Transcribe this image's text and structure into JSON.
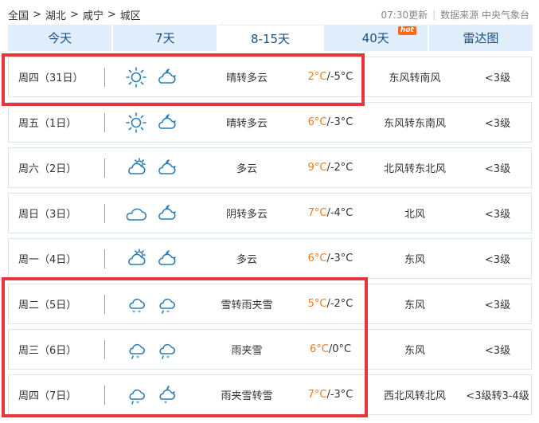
{
  "breadcrumb": [
    "全国",
    "湖北",
    "咸宁",
    "城区"
  ],
  "breadcrumb_sep": ">",
  "update": {
    "time": "07:30更新",
    "source": "数据来源 中央气象台"
  },
  "tabs": [
    {
      "label": "今天"
    },
    {
      "label": "7天"
    },
    {
      "label": "8-15天",
      "active": true
    },
    {
      "label": "40天",
      "badge": "hot"
    },
    {
      "label": "雷达图"
    }
  ],
  "forecast": [
    {
      "day": "周四（31日）",
      "icon_day": "sun-icon",
      "icon_night": "cloud-night-icon",
      "cond": "晴转多云",
      "hi": "2°C",
      "lo": "/-5°C",
      "wind": "东风转南风",
      "level": "<3级"
    },
    {
      "day": "周五（1日）",
      "icon_day": "sun-icon",
      "icon_night": "cloud-night-icon",
      "cond": "晴转多云",
      "hi": "6°C",
      "lo": "/-3°C",
      "wind": "东风转东南风",
      "level": "<3级"
    },
    {
      "day": "周六（2日）",
      "icon_day": "partly-cloudy-icon",
      "icon_night": "cloud-night-icon",
      "cond": "多云",
      "hi": "9°C",
      "lo": "/-2°C",
      "wind": "北风转东北风",
      "level": "<3级"
    },
    {
      "day": "周日（3日）",
      "icon_day": "cloud-icon",
      "icon_night": "cloud-night-icon",
      "cond": "阴转多云",
      "hi": "7°C",
      "lo": "/-4°C",
      "wind": "北风",
      "level": "<3级"
    },
    {
      "day": "周一（4日）",
      "icon_day": "partly-cloudy-icon",
      "icon_night": "cloud-night-icon",
      "cond": "多云",
      "hi": "6°C",
      "lo": "/-3°C",
      "wind": "东风",
      "level": "<3级"
    },
    {
      "day": "周二（5日）",
      "icon_day": "snow-cloud-icon",
      "icon_night": "sleet-cloud-icon",
      "cond": "雪转雨夹雪",
      "hi": "5°C",
      "lo": "/-2°C",
      "wind": "东风",
      "level": "<3级"
    },
    {
      "day": "周三（6日）",
      "icon_day": "sleet-cloud-icon",
      "icon_night": "sleet-cloud-icon",
      "cond": "雨夹雪",
      "hi": "6°C",
      "lo": "/0°C",
      "wind": "东风",
      "level": "<3级"
    },
    {
      "day": "周四（7日）",
      "icon_day": "sleet-cloud-icon",
      "icon_night": "snow-cloud-night-icon",
      "cond": "雨夹雪转雪",
      "hi": "7°C",
      "lo": "/-3°C",
      "wind": "西北风转北风",
      "level": "<3级转3-4级"
    }
  ],
  "colors": {
    "accent": "#1a4f86",
    "tab_bg": "#dfeefa",
    "hi_temp": "#f07c1f",
    "icon": "#2a7fb8",
    "highlight": "#e8343a"
  }
}
